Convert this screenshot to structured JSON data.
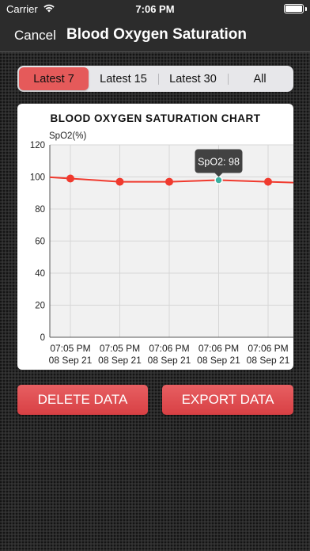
{
  "status_bar": {
    "carrier": "Carrier",
    "time": "7:06 PM"
  },
  "nav": {
    "cancel_label": "Cancel",
    "title": "Blood Oxygen Saturation"
  },
  "segments": [
    {
      "label": "Latest 7",
      "active": true
    },
    {
      "label": "Latest 15",
      "active": false
    },
    {
      "label": "Latest 30",
      "active": false
    },
    {
      "label": "All",
      "active": false
    }
  ],
  "colors": {
    "accent": "#e55a5a",
    "line": "#f03a2e",
    "selected_point": "#3aaf9f"
  },
  "chart_data": {
    "type": "line",
    "title": "BLOOD OXYGEN SATURATION CHART",
    "ylabel": "SpO2(%)",
    "ylim": [
      0,
      120
    ],
    "yticks": [
      0,
      20,
      40,
      60,
      80,
      100,
      120
    ],
    "grid": true,
    "categories": [
      [
        "07:05 PM",
        "08 Sep 21"
      ],
      [
        "07:05 PM",
        "08 Sep 21"
      ],
      [
        "07:06 PM",
        "08 Sep 21"
      ],
      [
        "07:06 PM",
        "08 Sep 21"
      ],
      [
        "07:06 PM",
        "08 Sep 21"
      ]
    ],
    "series": [
      {
        "values": [
          99,
          97,
          97,
          98,
          97
        ]
      }
    ],
    "tooltip": {
      "point_index": 3,
      "text": "SpO2: 98"
    }
  },
  "buttons": {
    "delete_label": "DELETE DATA",
    "export_label": "EXPORT DATA"
  }
}
